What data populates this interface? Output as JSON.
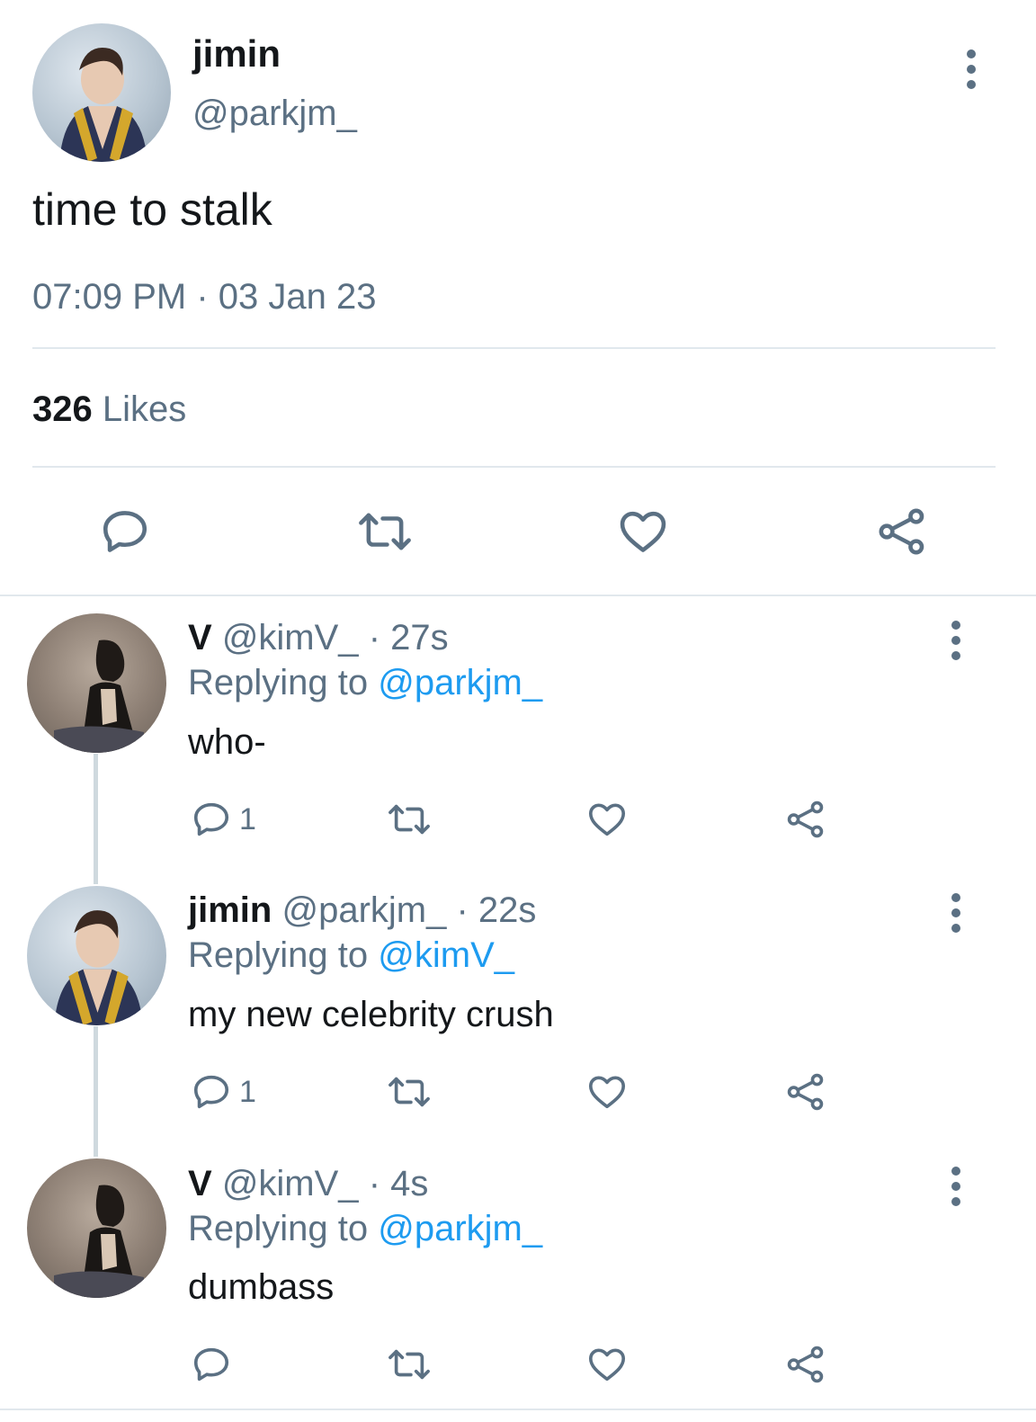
{
  "tweet": {
    "author_name": "jimin",
    "author_handle": "@parkjm_",
    "text": "time to stalk",
    "timestamp": "07:09 PM · 03 Jan 23",
    "likes_count": "326",
    "likes_label": "Likes"
  },
  "replies": [
    {
      "name": "V",
      "handle": "@kimV_",
      "time": "· 27s",
      "replying_label": "Replying to",
      "replying_to": "@parkjm_",
      "text": "who-",
      "reply_count": "1"
    },
    {
      "name": "jimin",
      "handle": "@parkjm_",
      "time": "· 22s",
      "replying_label": "Replying to",
      "replying_to": "@kimV_",
      "text": "my new celebrity crush",
      "reply_count": "1"
    },
    {
      "name": "V",
      "handle": "@kimV_",
      "time": "· 4s",
      "replying_label": "Replying to",
      "replying_to": "@parkjm_",
      "text": "dumbass",
      "reply_count": ""
    }
  ],
  "colors": {
    "text_primary": "#14171a",
    "text_secondary": "#5b7083",
    "mention": "#1d9bf0",
    "divider": "#e1e8ed"
  },
  "icons": [
    "reply-icon",
    "retweet-icon",
    "like-icon",
    "share-icon",
    "more-options-icon"
  ]
}
